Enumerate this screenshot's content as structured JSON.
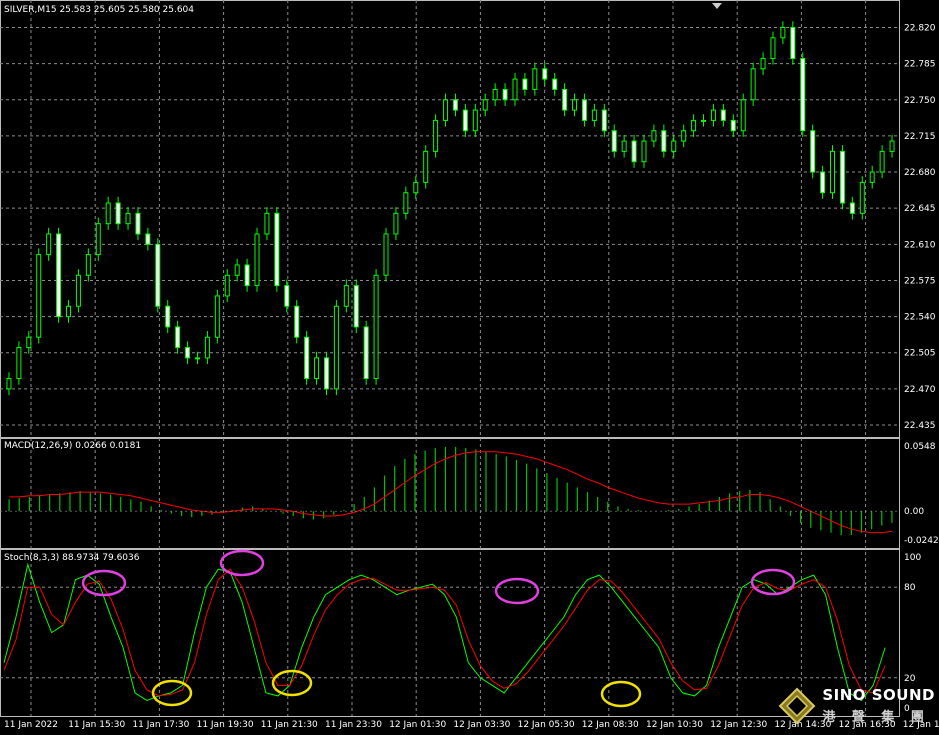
{
  "header": {
    "title": "SILVER,M15",
    "ohlc": "25.583 25.605 25.580 25.604"
  },
  "price_axis_labels": [
    "22.820",
    "22.785",
    "22.750",
    "22.715",
    "22.680",
    "22.645",
    "22.610",
    "22.575",
    "22.540",
    "22.505",
    "22.470",
    "22.435"
  ],
  "macd": {
    "label": "MACD(12,26,9) 0.0266 0.0181",
    "axis_labels": [
      "0.0548",
      "0.00",
      "-0.0242"
    ]
  },
  "stoch": {
    "label": "Stoch(8,3,3) 88.9734 79.6036",
    "axis_labels": [
      "100",
      "80",
      "20",
      "0"
    ]
  },
  "time_labels": [
    "11 Jan 2022",
    "11 Jan 15:30",
    "11 Jan 17:30",
    "11 Jan 19:30",
    "11 Jan 21:30",
    "11 Jan 23:30",
    "12 Jan 01:30",
    "12 Jan 03:30",
    "12 Jan 05:30",
    "12 Jan 08:30",
    "12 Jan 10:30",
    "12 Jan 12:30",
    "12 Jan 14:30",
    "12 Jan 16:30",
    "12 Jan 18:"
  ],
  "watermark": {
    "main": "SINO SOUND",
    "sub": "港 聲 集 團"
  },
  "colors": {
    "background": "#000000",
    "grid": "#8c8c8c",
    "candle": "#00ff00",
    "signal": "#ff0000",
    "macd_hist": "#00c000",
    "highlight_overbought": "#e040e0",
    "highlight_oversold": "#f0e000"
  },
  "chart_data": {
    "type": "candlestick",
    "symbol": "SILVER",
    "timeframe": "M15",
    "ylim": [
      22.435,
      22.835
    ],
    "price_close": [
      22.48,
      22.51,
      22.52,
      22.6,
      22.62,
      22.54,
      22.55,
      22.58,
      22.6,
      22.63,
      22.65,
      22.63,
      22.64,
      22.62,
      22.61,
      22.55,
      22.53,
      22.51,
      22.5,
      22.5,
      22.52,
      22.56,
      22.58,
      22.59,
      22.57,
      22.62,
      22.64,
      22.57,
      22.55,
      22.52,
      22.48,
      22.5,
      22.47,
      22.55,
      22.57,
      22.53,
      22.48,
      22.58,
      22.62,
      22.64,
      22.66,
      22.67,
      22.7,
      22.73,
      22.75,
      22.74,
      22.72,
      22.74,
      22.75,
      22.76,
      22.75,
      22.77,
      22.76,
      22.78,
      22.77,
      22.76,
      22.74,
      22.75,
      22.73,
      22.74,
      22.72,
      22.7,
      22.71,
      22.69,
      22.71,
      22.72,
      22.7,
      22.71,
      22.72,
      22.73,
      22.73,
      22.74,
      22.73,
      22.72,
      22.75,
      22.78,
      22.79,
      22.81,
      22.82,
      22.79,
      22.72,
      22.68,
      22.66,
      22.7,
      22.65,
      22.64,
      22.67,
      22.68,
      22.7,
      22.71
    ],
    "macd": [
      0.01,
      0.011,
      0.012,
      0.013,
      0.014,
      0.015,
      0.016,
      0.017,
      0.016,
      0.015,
      0.014,
      0.012,
      0.01,
      0.008,
      0.004,
      0.001,
      -0.002,
      -0.004,
      -0.005,
      -0.004,
      -0.003,
      -0.001,
      0.001,
      0.003,
      0.004,
      0.002,
      0.0,
      -0.002,
      -0.004,
      -0.006,
      -0.007,
      -0.006,
      -0.003,
      0.001,
      0.006,
      0.012,
      0.02,
      0.03,
      0.038,
      0.044,
      0.048,
      0.051,
      0.053,
      0.054,
      0.054,
      0.053,
      0.052,
      0.05,
      0.048,
      0.046,
      0.043,
      0.04,
      0.036,
      0.032,
      0.028,
      0.024,
      0.02,
      0.016,
      0.012,
      0.008,
      0.004,
      0.002,
      0.001,
      0.0,
      0.0,
      0.001,
      0.002,
      0.004,
      0.006,
      0.009,
      0.012,
      0.015,
      0.017,
      0.018,
      0.016,
      0.01,
      0.004,
      -0.004,
      -0.01,
      -0.014,
      -0.016,
      -0.018,
      -0.02,
      -0.02,
      -0.018,
      -0.015,
      -0.012,
      -0.01
    ],
    "macd_signal": [
      0.012,
      0.012,
      0.013,
      0.013,
      0.014,
      0.014,
      0.015,
      0.016,
      0.016,
      0.016,
      0.015,
      0.014,
      0.013,
      0.011,
      0.009,
      0.007,
      0.005,
      0.003,
      0.001,
      0.0,
      -0.001,
      -0.001,
      0.0,
      0.001,
      0.002,
      0.002,
      0.002,
      0.001,
      0.0,
      -0.002,
      -0.003,
      -0.004,
      -0.004,
      -0.003,
      -0.001,
      0.002,
      0.006,
      0.012,
      0.018,
      0.024,
      0.03,
      0.035,
      0.04,
      0.044,
      0.047,
      0.049,
      0.05,
      0.05,
      0.05,
      0.049,
      0.048,
      0.046,
      0.044,
      0.041,
      0.038,
      0.035,
      0.031,
      0.027,
      0.024,
      0.02,
      0.017,
      0.014,
      0.011,
      0.009,
      0.007,
      0.006,
      0.006,
      0.006,
      0.007,
      0.008,
      0.009,
      0.011,
      0.012,
      0.014,
      0.014,
      0.013,
      0.011,
      0.008,
      0.004,
      0.0,
      -0.004,
      -0.008,
      -0.012,
      -0.015,
      -0.017,
      -0.018,
      -0.018,
      -0.017
    ],
    "stoch_k": [
      30,
      60,
      95,
      70,
      50,
      55,
      85,
      88,
      82,
      60,
      40,
      10,
      5,
      8,
      10,
      15,
      50,
      80,
      92,
      90,
      70,
      40,
      10,
      8,
      15,
      40,
      60,
      75,
      80,
      85,
      88,
      85,
      80,
      75,
      78,
      80,
      82,
      75,
      60,
      30,
      20,
      15,
      10,
      20,
      30,
      40,
      50,
      60,
      75,
      85,
      88,
      80,
      70,
      60,
      50,
      40,
      20,
      10,
      8,
      15,
      40,
      60,
      80,
      85,
      82,
      75,
      80,
      85,
      88,
      75,
      40,
      10,
      5,
      15,
      40
    ],
    "stoch_d": [
      25,
      45,
      80,
      80,
      62,
      55,
      70,
      82,
      84,
      72,
      52,
      25,
      12,
      8,
      9,
      12,
      30,
      62,
      85,
      92,
      80,
      58,
      30,
      15,
      15,
      28,
      48,
      65,
      75,
      82,
      85,
      86,
      82,
      78,
      78,
      79,
      80,
      78,
      68,
      45,
      28,
      18,
      13,
      16,
      24,
      34,
      44,
      54,
      66,
      78,
      85,
      84,
      76,
      66,
      56,
      46,
      30,
      18,
      12,
      13,
      28,
      48,
      68,
      80,
      83,
      79,
      78,
      82,
      85,
      80,
      58,
      28,
      12,
      10,
      28
    ],
    "overbought_markers": [
      "11 Jan 15:30",
      "11 Jan 19:30",
      "12 Jan 05:30",
      "12 Jan 12:30"
    ],
    "oversold_markers": [
      "11 Jan 17:30",
      "11 Jan 21:30",
      "12 Jan 08:30"
    ]
  }
}
